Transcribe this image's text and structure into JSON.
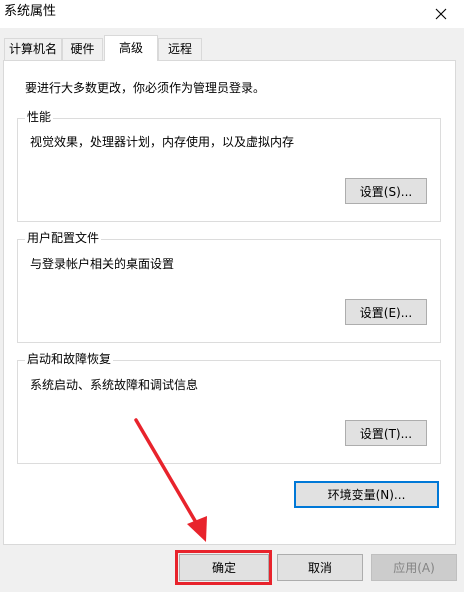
{
  "window": {
    "title": "系统属性",
    "close_icon": "close-icon"
  },
  "tabs": [
    {
      "label": "计算机名",
      "active": false
    },
    {
      "label": "硬件",
      "active": false
    },
    {
      "label": "高级",
      "active": true
    },
    {
      "label": "远程",
      "active": false
    }
  ],
  "advanced": {
    "intro": "要进行大多数更改，你必须作为管理员登录。",
    "performance": {
      "label": "性能",
      "description": "视觉效果，处理器计划，内存使用，以及虚拟内存",
      "button": "设置(S)..."
    },
    "user_profiles": {
      "label": "用户配置文件",
      "description": "与登录帐户相关的桌面设置",
      "button": "设置(E)..."
    },
    "startup_recovery": {
      "label": "启动和故障恢复",
      "description": "系统启动、系统故障和调试信息",
      "button": "设置(T)..."
    },
    "env_vars_button": "环境变量(N)..."
  },
  "footer": {
    "ok": "确定",
    "cancel": "取消",
    "apply": "应用(A)",
    "apply_disabled": true
  },
  "annotation": {
    "color": "#e8232c",
    "target": "ok-button"
  }
}
